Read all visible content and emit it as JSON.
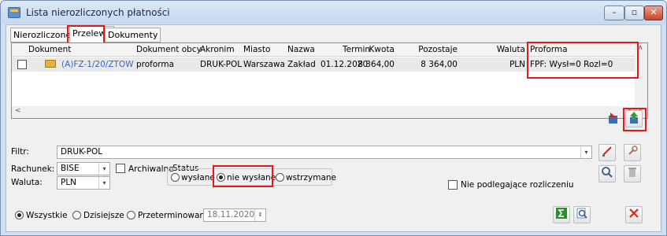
{
  "window": {
    "title": "Lista nierozliczonych płatności",
    "min_glyph": "–",
    "max_glyph": "▫",
    "close_glyph": "✕"
  },
  "tabs": [
    {
      "label": "Nierozliczone"
    },
    {
      "label": "Przelewy"
    },
    {
      "label": "Dokumenty"
    }
  ],
  "table": {
    "columns": [
      "Dokument",
      "Dokument obcy",
      "Akronim",
      "Miasto",
      "Nazwa",
      "Termin",
      "Kwota",
      "Pozostaje",
      "Waluta",
      "Proforma"
    ],
    "rows": [
      {
        "dokument": "(A)FZ-1/20/ZTOW",
        "dokument_obcy": "proforma",
        "akronim": "DRUK-POL",
        "miasto": "Warszawa",
        "nazwa": "Zakład",
        "termin": "01.12.2020",
        "kwota": "8 364,00",
        "pozostaje": "8 364,00",
        "waluta": "PLN",
        "proforma": "FPF: Wysł=0 Rozl=0"
      }
    ]
  },
  "filters": {
    "filtr_label": "Filtr:",
    "filtr_value": "DRUK-POL",
    "rachunek_label": "Rachunek:",
    "rachunek_value": "BISE",
    "archiwalne_label": "Archiwalne",
    "waluta_label": "Waluta:",
    "waluta_value": "PLN",
    "status_label": "Status",
    "status_options": [
      "wysłane",
      "nie wysłane",
      "wstrzymane"
    ],
    "status_selected": "nie wysłane",
    "nie_podlegajace_label": "Nie podlegające rozliczeniu"
  },
  "bottom": {
    "options": [
      "Wszystkie",
      "Dzisiejsze",
      "Przeterminowane"
    ],
    "selected": "Wszystkie",
    "date_value": "18.11.2020"
  },
  "colors": {
    "highlight": "#e21a1a",
    "link_blue": "#3366cc",
    "sum_green": "#2e8b2e",
    "close_red": "#d9261c"
  }
}
